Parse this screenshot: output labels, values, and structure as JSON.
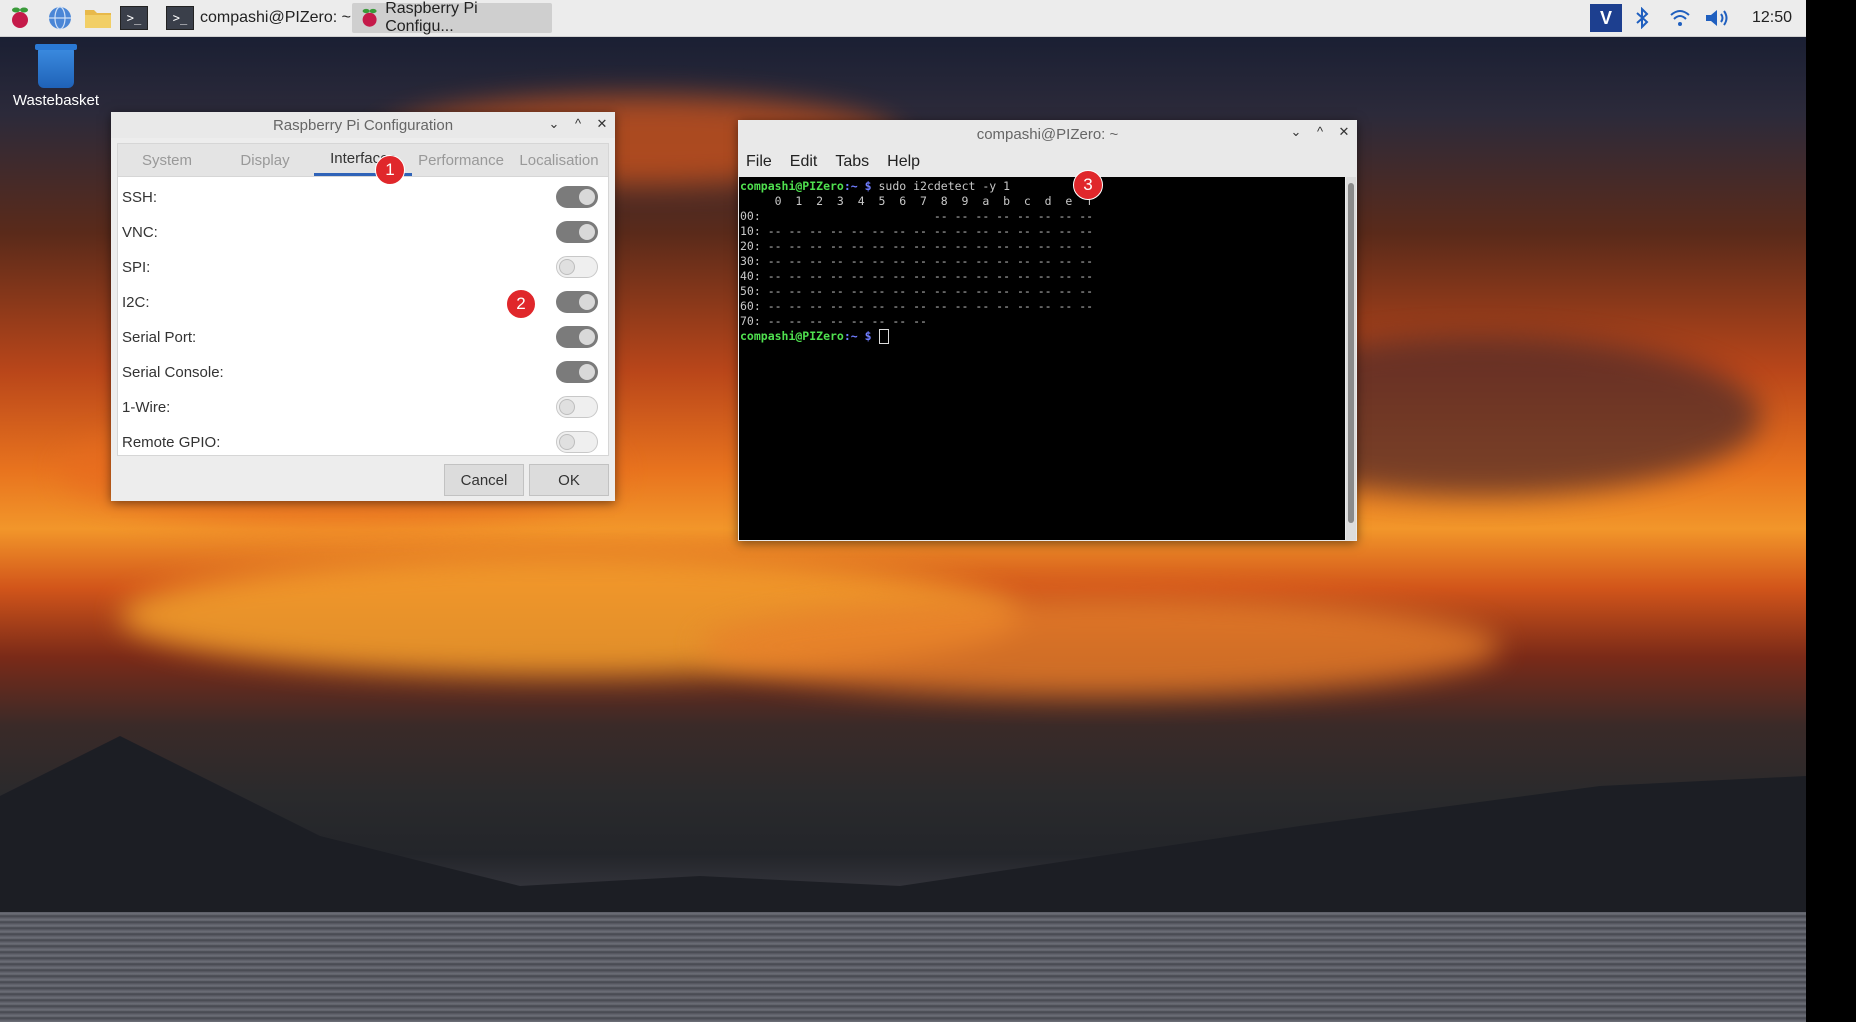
{
  "taskbar": {
    "tasks": [
      {
        "label": "compashi@PIZero: ~",
        "active": false
      },
      {
        "label": "Raspberry Pi Configu...",
        "active": true
      }
    ],
    "clock": "12:50"
  },
  "desktop": {
    "icons": [
      {
        "label": "Wastebasket"
      }
    ]
  },
  "config_dialog": {
    "title": "Raspberry Pi Configuration",
    "tabs": [
      "System",
      "Display",
      "Interfaces",
      "Performance",
      "Localisation"
    ],
    "active_tab": "Interfaces",
    "interfaces": [
      {
        "label": "SSH:",
        "enabled": true
      },
      {
        "label": "VNC:",
        "enabled": true
      },
      {
        "label": "SPI:",
        "enabled": false
      },
      {
        "label": "I2C:",
        "enabled": true
      },
      {
        "label": "Serial Port:",
        "enabled": true
      },
      {
        "label": "Serial Console:",
        "enabled": true
      },
      {
        "label": "1-Wire:",
        "enabled": false
      },
      {
        "label": "Remote GPIO:",
        "enabled": false
      }
    ],
    "cancel_label": "Cancel",
    "ok_label": "OK"
  },
  "terminal": {
    "title": "compashi@PIZero: ~",
    "menu": [
      "File",
      "Edit",
      "Tabs",
      "Help"
    ],
    "prompt_user": "compashi@PIZero",
    "prompt_path": ":~ $",
    "command": "sudo i2cdetect -y 1",
    "output": [
      "     0  1  2  3  4  5  6  7  8  9  a  b  c  d  e  f",
      "00:                         -- -- -- -- -- -- -- --",
      "10: -- -- -- -- -- -- -- -- -- -- -- -- -- -- -- --",
      "20: -- -- -- -- -- -- -- -- -- -- -- -- -- -- -- --",
      "30: -- -- -- -- -- -- -- -- -- -- -- -- -- -- -- --",
      "40: -- -- -- -- -- -- -- -- -- -- -- -- -- -- -- --",
      "50: -- -- -- -- -- -- -- -- -- -- -- -- -- -- -- --",
      "60: -- -- -- -- -- -- -- -- -- -- -- -- -- -- -- --",
      "70: -- -- -- -- -- -- -- --"
    ]
  },
  "markers": [
    "1",
    "2",
    "3"
  ],
  "colors": {
    "marker": "#e0272b",
    "active_tab_underline": "#2f63b8",
    "prompt_user": "#4fe04f",
    "prompt_path": "#6f7dff"
  }
}
